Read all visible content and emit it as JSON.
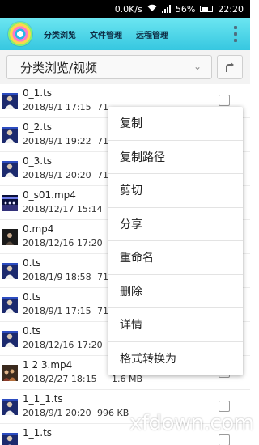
{
  "status_bar": {
    "speed": "0.0K/s",
    "battery": "56%",
    "time": "22:20"
  },
  "header": {
    "tabs": [
      "分类浏览",
      "文件管理",
      "远程管理"
    ]
  },
  "path_bar": {
    "current": "分类浏览/视频"
  },
  "files": [
    {
      "name": "0_1.ts",
      "date": "2018/9/1 17:15",
      "size": "71",
      "thumb": "person"
    },
    {
      "name": "0_2.ts",
      "date": "2018/9/1 19:22",
      "size": "71",
      "thumb": "person"
    },
    {
      "name": "0_3.ts",
      "date": "2018/9/1 20:20",
      "size": "71",
      "thumb": "person"
    },
    {
      "name": "0_s01.mp4",
      "date": "2018/12/17 15:14",
      "size": "",
      "thumb": "stage"
    },
    {
      "name": "0.mp4",
      "date": "2018/12/16 17:20",
      "size": "",
      "thumb": "dark"
    },
    {
      "name": "0.ts",
      "date": "2018/1/9 18:58",
      "size": "71",
      "thumb": "person"
    },
    {
      "name": "0.ts",
      "date": "2018/9/1 17:15",
      "size": "71",
      "thumb": "person"
    },
    {
      "name": "0.ts",
      "date": "2018/12/16 17:20",
      "size": "",
      "thumb": "person"
    },
    {
      "name": "1 2 3.mp4",
      "date": "2018/2/27 18:15",
      "size": "1.6 MB",
      "thumb": "crowd"
    },
    {
      "name": "1_1_1.ts",
      "date": "2018/9/1 20:20",
      "size": "996 KB",
      "thumb": "person"
    },
    {
      "name": "1_1.ts",
      "date": "",
      "size": "",
      "thumb": "person"
    }
  ],
  "context_menu": {
    "items": [
      "复制",
      "复制路径",
      "剪切",
      "分享",
      "重命名",
      "删除",
      "详情",
      "格式转换为"
    ]
  },
  "watermark": "xfdown.com",
  "colors": {
    "header_top": "#6ce6f1",
    "header_bottom": "#36c7e0"
  }
}
